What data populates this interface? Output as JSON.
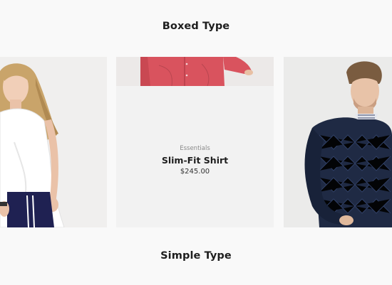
{
  "sections": {
    "boxed_title": "Boxed Type",
    "simple_title": "Simple Type"
  },
  "products": {
    "featured": {
      "category": "Essentials",
      "name": "Slim-Fit Shirt",
      "price": "$245.00"
    }
  },
  "colors": {
    "background": "#f9f9f9",
    "card": "#f2f2f2",
    "text": "#1e1e1e",
    "muted": "#8a8a8a",
    "shirt": "#d9535e",
    "sweater": "#1f2a44"
  },
  "images": {
    "left": "woman-white-top-photo",
    "middle": "red-shirt-photo",
    "right": "man-quilted-sweater-photo"
  }
}
